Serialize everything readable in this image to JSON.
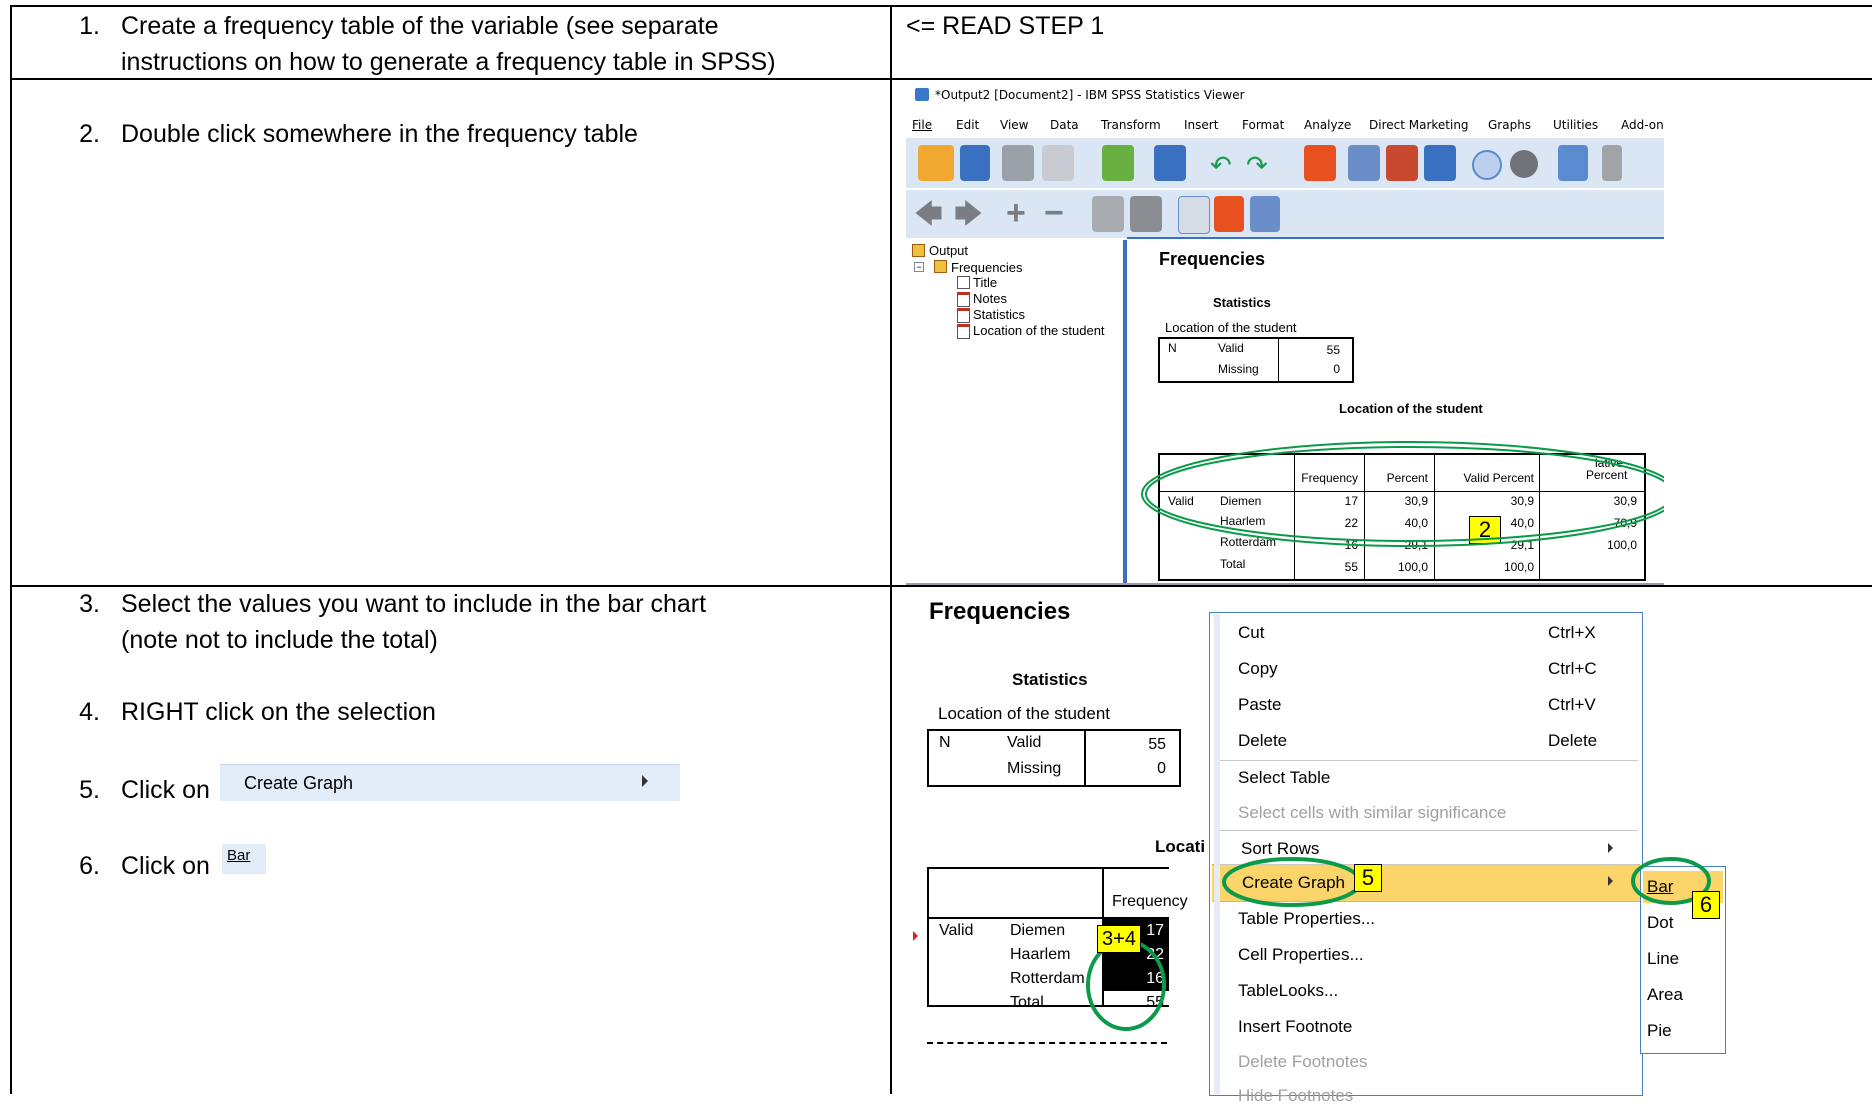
{
  "steps": {
    "s1": {
      "num": "1.",
      "line1": "Create a frequency table of the variable (see separate",
      "line2": "instructions on how to generate a frequency table in SPSS)"
    },
    "read_step": "<= READ STEP 1",
    "s2": {
      "num": "2.",
      "text": "Double click somewhere in the frequency table"
    },
    "s3": {
      "num": "3.",
      "line1": "Select the values you want to include in the bar chart",
      "line2": "(note not to include the total)"
    },
    "s4": {
      "num": "4.",
      "text": "RIGHT click on the selection"
    },
    "s5": {
      "num": "5.",
      "text": "Click on",
      "button": "Create Graph"
    },
    "s6": {
      "num": "6.",
      "text": "Click on",
      "button": "Bar"
    }
  },
  "viewer": {
    "title": "*Output2 [Document2] - IBM SPSS Statistics Viewer",
    "menu": [
      "File",
      "Edit",
      "View",
      "Data",
      "Transform",
      "Insert",
      "Format",
      "Analyze",
      "Direct Marketing",
      "Graphs",
      "Utilities",
      "Add-on"
    ],
    "tree": {
      "root": "Output",
      "group": "Frequencies",
      "items": [
        "Title",
        "Notes",
        "Statistics",
        "Location of the student"
      ]
    },
    "heading": "Frequencies",
    "stats_title": "Statistics",
    "stats_label": "Location of the student",
    "stats_rows": [
      {
        "a": "N",
        "b": "Valid",
        "v": "55"
      },
      {
        "a": "",
        "b": "Missing",
        "v": "0"
      }
    ],
    "freq_title": "Location of the student",
    "freq_headers": [
      "Frequency",
      "Percent",
      "Valid Percent",
      "Cumulative Percent"
    ],
    "freq_header_partial": {
      "top": "lative",
      "bottom": "Percent"
    },
    "freq_rows": [
      {
        "g": "Valid",
        "c": "Diemen",
        "f": "17",
        "p": "30,9",
        "vp": "30,9",
        "cp": "30,9"
      },
      {
        "g": "",
        "c": "Haarlem",
        "f": "22",
        "p": "40,0",
        "vp": "40,0",
        "cp": "70,9"
      },
      {
        "g": "",
        "c": "Rotterdam",
        "f": "16",
        "p": "29,1",
        "vp": "29,1",
        "cp": "100,0"
      },
      {
        "g": "",
        "c": "Total",
        "f": "55",
        "p": "100,0",
        "vp": "100,0",
        "cp": ""
      }
    ],
    "badge": "2"
  },
  "context": {
    "heading": "Frequencies",
    "stats_title": "Statistics",
    "stats_label": "Location of the student",
    "stats_rows": [
      {
        "a": "N",
        "b": "Valid",
        "v": "55"
      },
      {
        "a": "",
        "b": "Missing",
        "v": "0"
      }
    ],
    "partial_title": "Locati",
    "freq_header": "Frequency",
    "rows": [
      {
        "g": "Valid",
        "c": "Diemen",
        "f": "17"
      },
      {
        "g": "",
        "c": "Haarlem",
        "f": "22"
      },
      {
        "g": "",
        "c": "Rotterdam",
        "f": "16"
      },
      {
        "g": "",
        "c": "Total",
        "f": "55"
      }
    ],
    "badge_sel": "3+4",
    "menu": [
      {
        "label": "Cut",
        "shortcut": "Ctrl+X",
        "enabled": true
      },
      {
        "label": "Copy",
        "shortcut": "Ctrl+C",
        "enabled": true
      },
      {
        "label": "Paste",
        "shortcut": "Ctrl+V",
        "enabled": true
      },
      {
        "label": "Delete",
        "shortcut": "Delete",
        "enabled": true
      },
      {
        "label": "Select Table",
        "shortcut": "",
        "enabled": true
      },
      {
        "label": "Select cells with similar significance",
        "shortcut": "",
        "enabled": false
      },
      {
        "label": "Sort Rows",
        "shortcut": "",
        "enabled": true
      },
      {
        "label": "Create Graph",
        "shortcut": "",
        "enabled": true
      },
      {
        "label": "Table Properties...",
        "shortcut": "",
        "enabled": true
      },
      {
        "label": "Cell Properties...",
        "shortcut": "",
        "enabled": true
      },
      {
        "label": "TableLooks...",
        "shortcut": "",
        "enabled": true
      },
      {
        "label": "Insert Footnote",
        "shortcut": "",
        "enabled": true
      },
      {
        "label": "Delete Footnotes",
        "shortcut": "",
        "enabled": false
      },
      {
        "label": "Hide Footnotes",
        "shortcut": "",
        "enabled": false
      }
    ],
    "submenu": [
      "Bar",
      "Dot",
      "Line",
      "Area",
      "Pie"
    ],
    "badge5": "5",
    "badge6": "6"
  },
  "colors": {
    "green_circle": "#0a9a4a",
    "badge": "#ffff00",
    "menu_highlight": "#fbd46a",
    "menu_border": "#4a7ec2"
  }
}
